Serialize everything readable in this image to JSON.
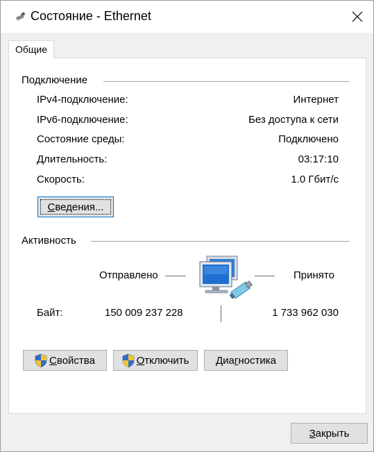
{
  "window": {
    "title": "Состояние - Ethernet",
    "close_icon": "close-icon",
    "title_icon": "ethernet-icon"
  },
  "tabs": [
    {
      "label": "Общие"
    }
  ],
  "connection": {
    "group_title": "Подключение",
    "rows": [
      {
        "label": "IPv4-подключение:",
        "value": "Интернет"
      },
      {
        "label": "IPv6-подключение:",
        "value": "Без доступа к сети"
      },
      {
        "label": "Состояние среды:",
        "value": "Подключено"
      },
      {
        "label": "Длительность:",
        "value": "03:17:10"
      },
      {
        "label": "Скорость:",
        "value": "1.0 Гбит/с"
      }
    ],
    "details_button": {
      "label": "Сведения...",
      "mnemonic": "С",
      "rest": "ведения..."
    }
  },
  "activity": {
    "group_title": "Активность",
    "sent_label": "Отправлено",
    "received_label": "Принято",
    "bytes_label": "Байт:",
    "bytes_sent": "150 009 237 228",
    "bytes_received": "1 733 962 030",
    "network_icon": "network-computers-icon"
  },
  "buttons": {
    "properties": {
      "label": "Свойства",
      "mnemonic": "С",
      "rest": "войства",
      "icon": "uac-shield-icon"
    },
    "disable": {
      "label": "Отключить",
      "mnemonic": "О",
      "rest": "тключить",
      "icon": "uac-shield-icon"
    },
    "diagnose": {
      "label": "Диагностика",
      "before": "Диа",
      "mnemonic": "г",
      "rest": "ностика"
    },
    "close": {
      "label": "Закрыть",
      "mnemonic": "З",
      "rest": "акрыть"
    }
  },
  "colors": {
    "accent": "#0078d7",
    "button_face": "#e1e1e1",
    "window_bg": "#f0f0f0",
    "panel_bg": "#ffffff"
  }
}
